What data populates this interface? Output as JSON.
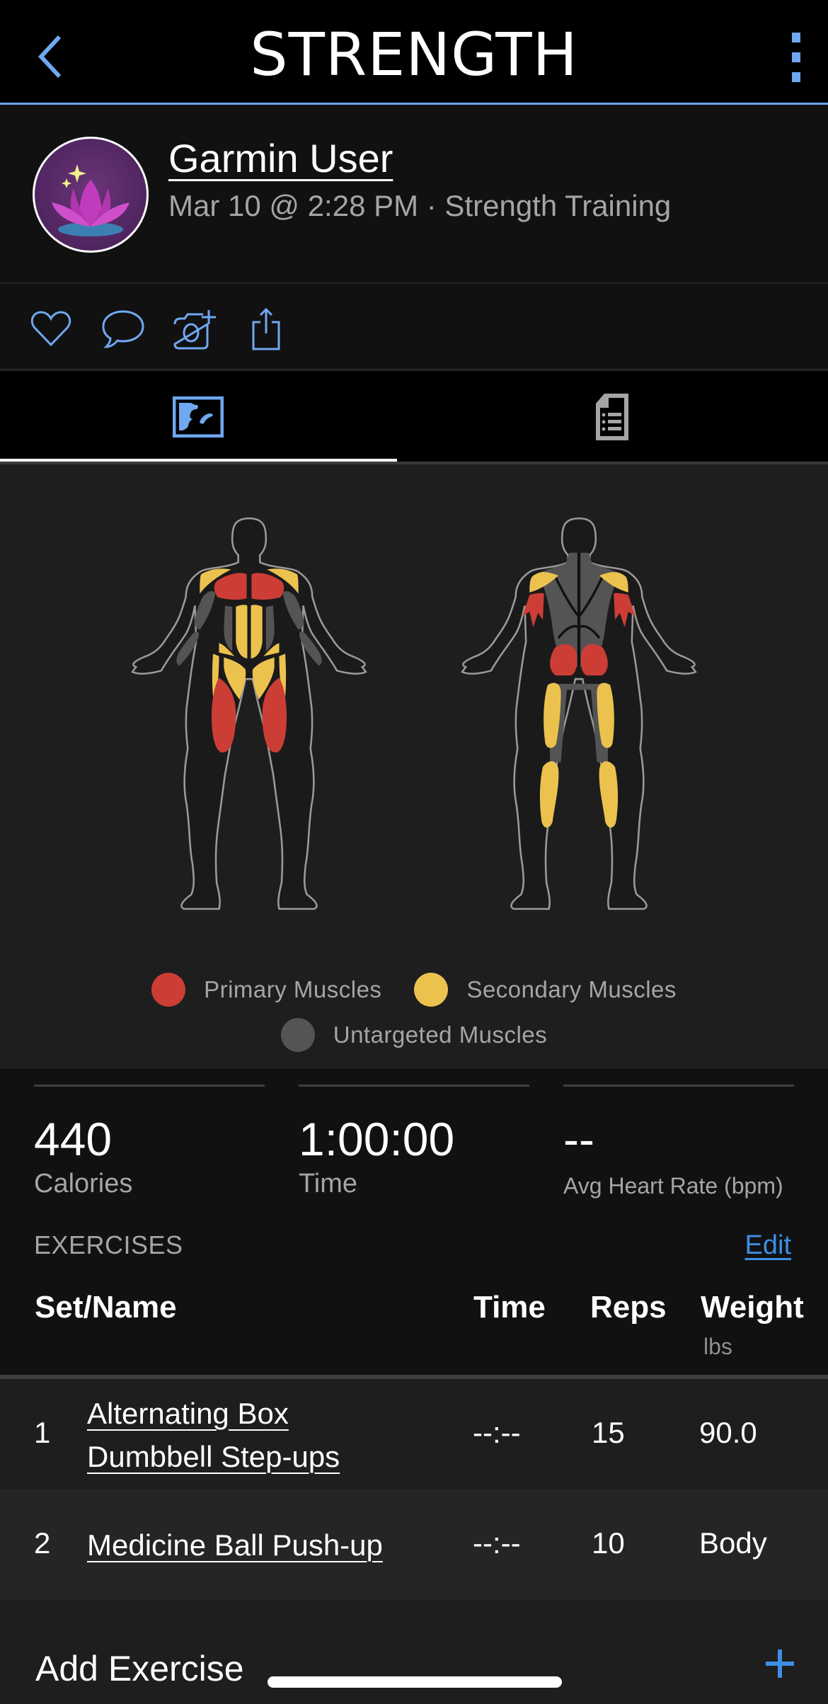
{
  "header": {
    "title": "STRENGTH",
    "back_icon": "chevron-left-icon",
    "menu_icon": "more-vertical-icon"
  },
  "profile": {
    "user_name": "Garmin User",
    "activity_meta": "Mar 10 @ 2:28 PM · Strength Training",
    "avatar_icon": "lotus-avatar-icon"
  },
  "actions": [
    {
      "name": "like",
      "icon": "heart-icon"
    },
    {
      "name": "comment",
      "icon": "comment-icon"
    },
    {
      "name": "add-photo",
      "icon": "camera-plus-icon"
    },
    {
      "name": "share",
      "icon": "share-icon"
    }
  ],
  "tabs": [
    {
      "name": "muscle-map",
      "icon": "muscle-map-icon",
      "active": true
    },
    {
      "name": "details",
      "icon": "document-list-icon",
      "active": false
    }
  ],
  "muscle_map": {
    "colors": {
      "primary": "#cc3d35",
      "secondary": "#ecc24f",
      "untargeted": "#545454",
      "accent": "#6fa8f0",
      "link": "#3d8fe6"
    },
    "front": {
      "primary": [
        "chest",
        "quadriceps"
      ],
      "secondary": [
        "shoulders",
        "abs",
        "hip flexors",
        "adductors"
      ],
      "untargeted": [
        "biceps",
        "forearms",
        "obliques"
      ]
    },
    "back": {
      "primary": [
        "triceps",
        "glutes"
      ],
      "secondary": [
        "rear shoulders",
        "hamstrings",
        "calves"
      ],
      "untargeted": [
        "traps",
        "lats",
        "lower back"
      ]
    },
    "legend": [
      {
        "label": "Primary Muscles",
        "color": "#cc3d35"
      },
      {
        "label": "Secondary Muscles",
        "color": "#ecc24f"
      },
      {
        "label": "Untargeted Muscles",
        "color": "#545454"
      }
    ]
  },
  "stats": [
    {
      "value": "440",
      "label": "Calories"
    },
    {
      "value": "1:00:00",
      "label": "Time"
    },
    {
      "value": "--",
      "label": "Avg Heart Rate (bpm)"
    }
  ],
  "exercises": {
    "section_title": "EXERCISES",
    "edit_label": "Edit",
    "columns": {
      "set_name": "Set/Name",
      "time": "Time",
      "reps": "Reps",
      "weight": "Weight",
      "weight_unit": "lbs"
    },
    "rows": [
      {
        "set": "1",
        "name_line1": "Alternating Box",
        "name_line2": "Dumbbell Step-ups",
        "time": "--:--",
        "reps": "15",
        "weight": "90.0"
      },
      {
        "set": "2",
        "name_line1": "Medicine Ball Push-up",
        "name_line2": "",
        "time": "--:--",
        "reps": "10",
        "weight": "Body"
      }
    ],
    "add_label": "Add Exercise",
    "add_icon": "plus-icon"
  }
}
